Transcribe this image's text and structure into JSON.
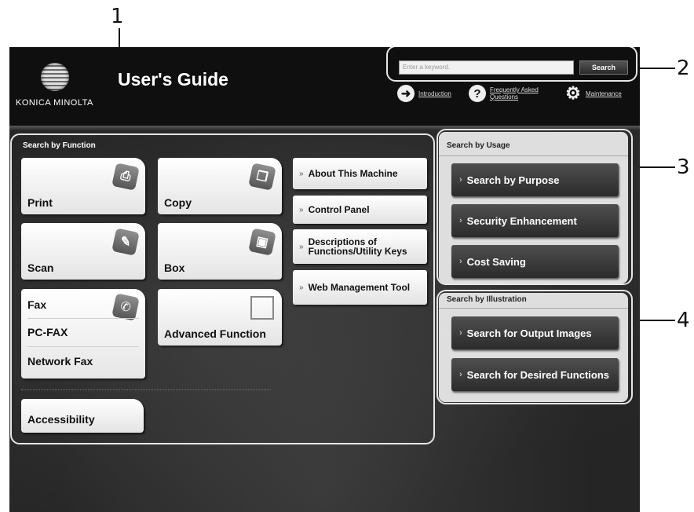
{
  "callouts": [
    "1",
    "2",
    "3",
    "4"
  ],
  "header": {
    "logo_text": "KONICA MINOLTA",
    "title": "User's Guide",
    "search_placeholder": "Enter a keyword.",
    "search_button": "Search",
    "links": [
      {
        "label": "Introduction",
        "icon": "arrow-right-icon"
      },
      {
        "label": "Frequently Asked Questions",
        "icon": "question-icon"
      },
      {
        "label": "Maintenance",
        "icon": "gear-icon"
      }
    ]
  },
  "function_panel": {
    "title": "Search by Function",
    "tiles": [
      {
        "label": "Print",
        "icon": "print-icon"
      },
      {
        "label": "Copy",
        "icon": "copy-icon"
      },
      {
        "label": "Scan",
        "icon": "scan-icon"
      },
      {
        "label": "Box",
        "icon": "box-icon"
      },
      {
        "label": "Advanced Function",
        "icon": "advanced-function-icon"
      }
    ],
    "fax_items": [
      "Fax",
      "PC-FAX",
      "Network Fax"
    ],
    "fax_icon": "fax-icon",
    "links": [
      "About This Machine",
      "Control Panel",
      "Descriptions of Functions/Utility Keys",
      "Web Management Tool"
    ],
    "accessibility": "Accessibility"
  },
  "usage_panel": {
    "title": "Search by Usage",
    "buttons": [
      "Search by Purpose",
      "Security Enhancement",
      "Cost Saving"
    ]
  },
  "illustration_panel": {
    "title": "Search by Illustration",
    "buttons": [
      "Search for Output Images",
      "Search for Desired Functions"
    ]
  }
}
